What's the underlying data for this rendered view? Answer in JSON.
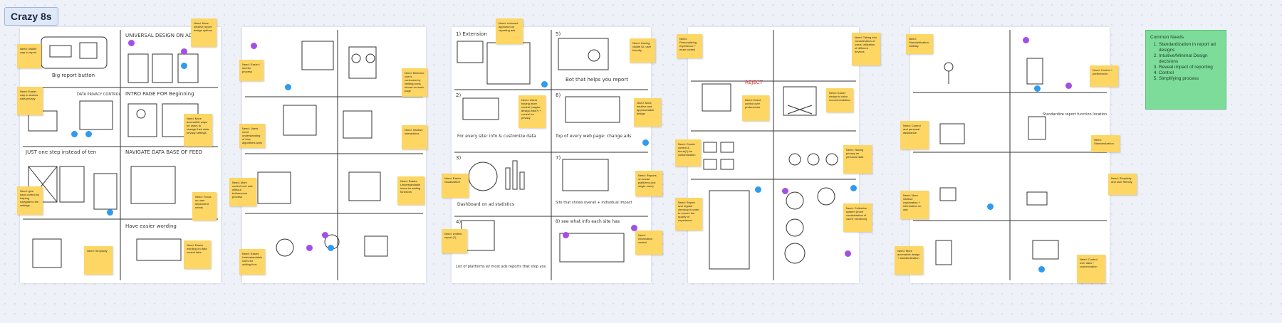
{
  "board_title": "Crazy 8s",
  "summary": {
    "title": "Common Needs",
    "items": [
      "Standardization in report ad designs",
      "Intuitive/Minimal Design decisions",
      "Reveal impact of reporting",
      "Control",
      "Simplifying process"
    ]
  },
  "sketch_text": [
    "Big report button",
    "UNIVERSAL DESIGN ON AD",
    "INTRO PAGE FOR Beginning",
    "DATA PRIVACY CONTROL",
    "JUST one step instead of ten",
    "NAVIGATE DATA BASE OF FEED",
    "Have easier wording",
    "1) Extension",
    "5)",
    "Bot that helps you report",
    "2)",
    "6)",
    "For every site: info & customize data",
    "Top of every web page: change ads",
    "3)",
    "7)",
    "Dashboard on ad statistics",
    "Site that shows overall + individual impact",
    "4)",
    "8) see what info each site has",
    "List of platforms w/ most ads reports that stop you",
    "REJECT",
    "Standardize report function location",
    "Common Needs"
  ],
  "notes": [
    "Need: Visible way to report",
    "Need: More intuitive report design options",
    "Need: Easier way to access data privacy",
    "Need: More accessible ways for users to change their data privacy settings",
    "Need: give back control by helping navigate to the settings",
    "Need: Focus on user dependent needs",
    "Need: Simplicity",
    "Need: Easier wording on data control tabs",
    "Need: Easier / shorter process",
    "Need: Users need understanding of how algorithms work",
    "Need: Minimize user's confusion by limiting icons shown on each page",
    "Need: Intuitive interactions",
    "Need: More control over ads without bothersome process",
    "Need: Easier; Understandable icons for adding functions",
    "Need: Easier; Understandable icons for adding func",
    "Need: a shared approach on reporting ads",
    "Need: Having visible UI, user friendly",
    "Need: Users having more control (maybe design wise?) + control for privacy",
    "Need: More intuitive and approachable design",
    "Need: Easier visualization",
    "Need: Reports on social platforms (not single ones)",
    "Need: Unified report (?)",
    "Need: Information control",
    "Need: Personalizing experience + more control",
    "Need: Taking into consideration of users' utilization of different devices",
    "Need: Direct control over preferences",
    "Need: Easier design to tailor recommendation",
    "Need: Create control & focus(?) for customization",
    "Need: Having privacy on personal data",
    "Need: Report and regular checkup in order to ensure the quality of experience",
    "Need: Collective system (more consideration of users' emotions)",
    "Need: Standardization, visibility",
    "Need: Control + preferences",
    "Need: Control and personal assistance",
    "Need: Standardization",
    "Need: More intuitive explanation + information on ads",
    "Need: Simplicity and user friendly",
    "Need: More accessible design + standardization",
    "Need: Control over data + customization"
  ],
  "colors": {
    "sticky": "#fdd663",
    "dot_blue": "#2d9cf0",
    "dot_purple": "#a14fe6",
    "summary_bg": "#7ddc9a"
  }
}
